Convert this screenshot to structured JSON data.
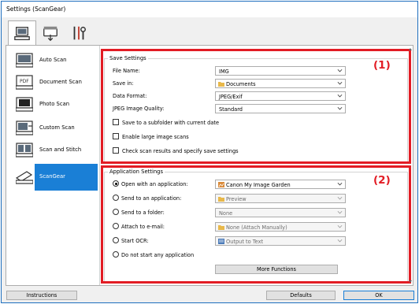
{
  "window": {
    "title": "Settings (ScanGear)"
  },
  "tabs": [
    {
      "icon": "scan-from-computer-icon"
    },
    {
      "icon": "scan-from-operation-panel-icon"
    },
    {
      "icon": "general-settings-icon"
    }
  ],
  "sidebar": {
    "items": [
      {
        "label": "Auto Scan",
        "icon": "auto-scan-icon"
      },
      {
        "label": "Document Scan",
        "icon": "document-scan-icon"
      },
      {
        "label": "Photo Scan",
        "icon": "photo-scan-icon"
      },
      {
        "label": "Custom Scan",
        "icon": "custom-scan-icon"
      },
      {
        "label": "Scan and Stitch",
        "icon": "scan-and-stitch-icon"
      },
      {
        "label": "ScanGear",
        "icon": "scangear-icon",
        "selected": true
      }
    ]
  },
  "save_settings": {
    "title": "Save Settings",
    "marker": "(1)",
    "file_name": {
      "label": "File Name:",
      "value": "IMG"
    },
    "save_in": {
      "label": "Save in:",
      "value": "Documents"
    },
    "data_format": {
      "label": "Data Format:",
      "value": "JPEG/Exif"
    },
    "jpeg_quality": {
      "label": "JPEG Image Quality:",
      "value": "Standard"
    },
    "checkboxes": [
      {
        "label": "Save to a subfolder with current date",
        "checked": false
      },
      {
        "label": "Enable large image scans",
        "checked": false
      },
      {
        "label": "Check scan results and specify save settings",
        "checked": false
      }
    ]
  },
  "app_settings": {
    "title": "Application Settings",
    "marker": "(2)",
    "options": [
      {
        "label": "Open with an application:",
        "value": "Canon My Image Garden",
        "selected": true,
        "enabled": true
      },
      {
        "label": "Send to an application:",
        "value": "Preview",
        "selected": false,
        "enabled": false
      },
      {
        "label": "Send to a folder:",
        "value": "None",
        "selected": false,
        "enabled": false
      },
      {
        "label": "Attach to e-mail:",
        "value": "None (Attach Manually)",
        "selected": false,
        "enabled": false
      },
      {
        "label": "Start OCR:",
        "value": "Output to Text",
        "selected": false,
        "enabled": false
      },
      {
        "label": "Do not start any application",
        "selected": false
      }
    ],
    "more_functions": "More Functions"
  },
  "footer": {
    "instructions": "Instructions",
    "defaults": "Defaults",
    "ok": "OK"
  },
  "colors": {
    "accent": "#1a7fd6",
    "highlight": "#e21c24"
  }
}
